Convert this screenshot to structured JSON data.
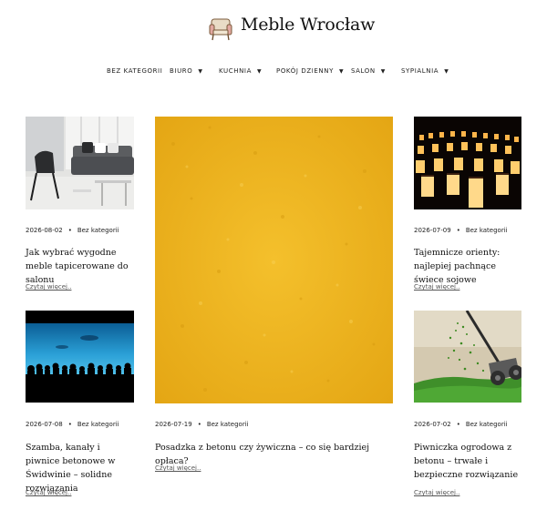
{
  "site": {
    "title": "Meble Wrocław",
    "logo_icon": "armchair-icon"
  },
  "nav": {
    "items": [
      {
        "label": "BEZ KATEGORII",
        "has_dropdown": false
      },
      {
        "label": "BIURO",
        "has_dropdown": true
      },
      {
        "label": "KUCHNIA",
        "has_dropdown": true
      },
      {
        "label": "POKÓJ DZIENNY",
        "has_dropdown": true
      },
      {
        "label": "SALON",
        "has_dropdown": true
      },
      {
        "label": "SYPIALNIA",
        "has_dropdown": true
      }
    ],
    "caret": "▼"
  },
  "posts": [
    {
      "date": "2026-08-02",
      "category": "Bez kategorii",
      "title": "Jak wybrać wygodne meble tapicerowane do salonu",
      "read_more": "Czytaj więcej..",
      "image": "living-room-sofa"
    },
    {
      "date": "2026-07-09",
      "category": "Bez kategorii",
      "title": "Tajemnicze orienty: najlepiej pachnące świece sojowe",
      "read_more": "Czytaj więcej..",
      "image": "candle-lanterns"
    },
    {
      "date": "2026-07-19",
      "category": "Bez kategorii",
      "title": "Posadzka z betonu czy żywiczna – co się bardziej opłaca?",
      "read_more": "Czytaj więcej..",
      "image": "yellow-textured-wall"
    },
    {
      "date": "2026-07-08",
      "category": "Bez kategorii",
      "title": "Szamba, kanały i piwnice betonowe w Świdwinie – solidne rozwiązania",
      "read_more": "Czytaj więcej..",
      "image": "aquarium-silhouettes"
    },
    {
      "date": "2026-07-02",
      "category": "Bez kategorii",
      "title": "Piwniczka ogrodowa z betonu – trwałe i bezpieczne rozwiązanie",
      "read_more": "Czytaj więcej..",
      "image": "lawn-mower-grass"
    }
  ],
  "colors": {
    "text": "#222222",
    "yellow": "#f0b824",
    "sky": "#1e7fb8"
  }
}
